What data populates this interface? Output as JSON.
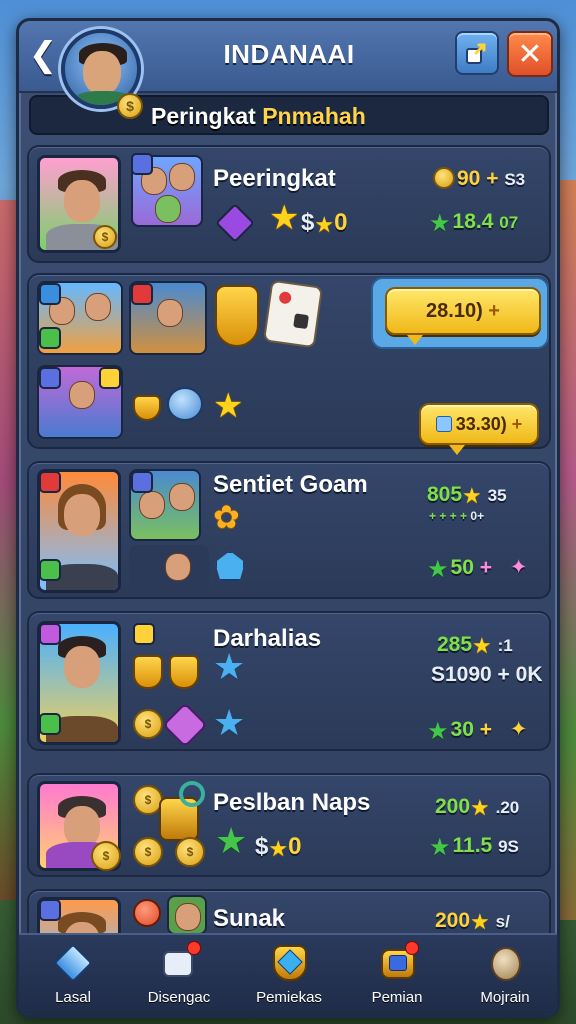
{
  "header": {
    "title": "INDANAAI",
    "subtitle_prefix": "Peringkat",
    "subtitle_accent": "Pnmahah",
    "back_icon": "arrow-left-icon",
    "share_icon": "share-icon",
    "close_icon": "close-icon"
  },
  "rows": [
    {
      "title": "Peeringkat",
      "stat1_value": "90",
      "stat1_suffix": "+",
      "stat1_small": "S3",
      "stat2_value": "18.4",
      "stat2_small": "07",
      "reward_text": "$",
      "reward_value": "0"
    },
    {
      "price1": "28.10)",
      "price2": "33.30)"
    },
    {
      "title": "Sentiet Goam",
      "stat1_value": "805",
      "stat1_small": "35",
      "stat1_sub": "+ + + +",
      "stat1_sub_small": "0+",
      "stat2_value": "50",
      "stat2_suffix": "+"
    },
    {
      "title": "Darhalias",
      "stat1_value": "285",
      "stat1_small": ":1",
      "stat_mid": "S1090 + 0K",
      "stat2_value": "30",
      "stat2_suffix": "+"
    },
    {
      "title": "Peslban Naps",
      "stat1_value": "200",
      "stat1_small": ".20",
      "stat2_value": "11.5",
      "stat2_small": "9S",
      "reward_text": "$",
      "reward_value": "0"
    },
    {
      "title": "Sunak",
      "stat1_value": "200",
      "stat1_small": "s/"
    }
  ],
  "nav": [
    {
      "label": "Lasal",
      "icon": "gem-icon"
    },
    {
      "label": "Disengac",
      "icon": "chat-icon"
    },
    {
      "label": "Pemiekas",
      "icon": "shield-gem-icon"
    },
    {
      "label": "Pemian",
      "icon": "chest-icon"
    },
    {
      "label": "Mojrain",
      "icon": "egg-icon"
    }
  ],
  "colors": {
    "panel": "#2f3f5e",
    "gold": "#ffd23a",
    "green": "#7fe04a",
    "close": "#e0502a",
    "share": "#3f7cc4"
  }
}
